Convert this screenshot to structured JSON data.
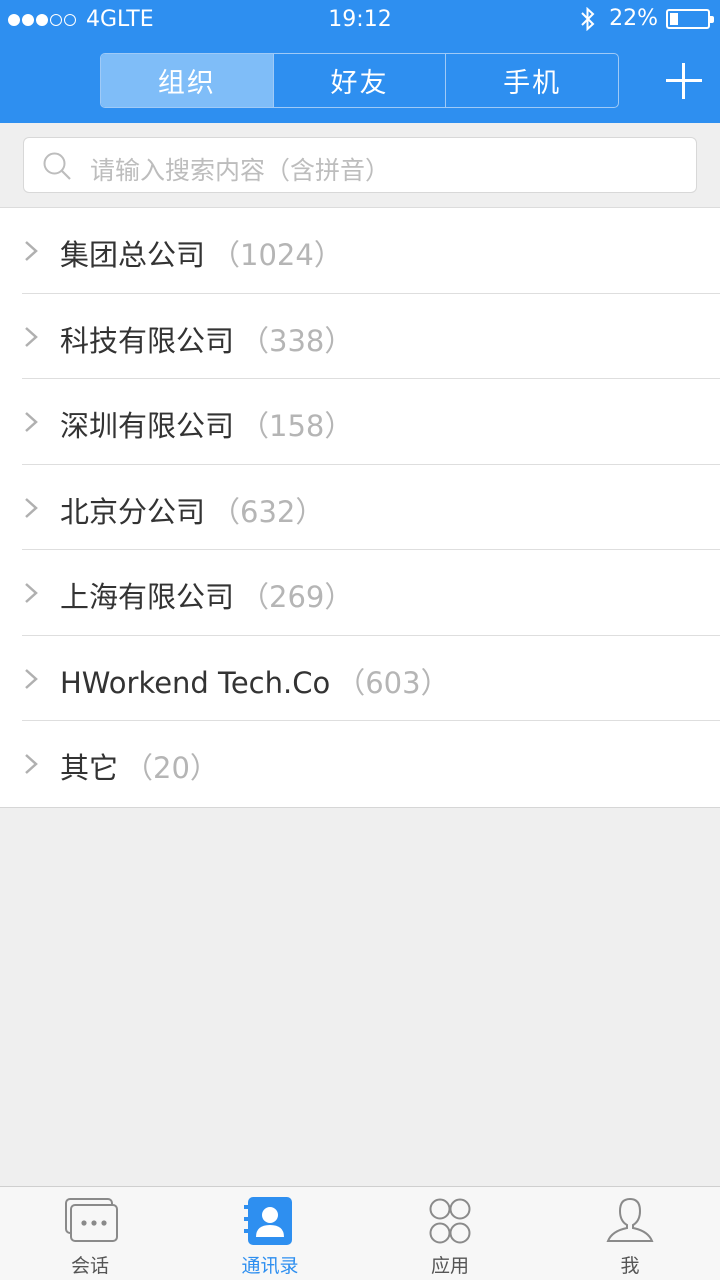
{
  "status_bar": {
    "carrier": "4GLTE",
    "time": "19:12",
    "battery": "22%",
    "battery_level": 0.22,
    "signal_bars": 3
  },
  "segments": [
    {
      "label": "组织",
      "active": true
    },
    {
      "label": "好友",
      "active": false
    },
    {
      "label": "手机",
      "active": false
    }
  ],
  "search": {
    "placeholder": "请输入搜索内容（含拼音）"
  },
  "groups": [
    {
      "name": "集团总公司",
      "count": "（1024）"
    },
    {
      "name": "科技有限公司",
      "count": "（338）"
    },
    {
      "name": "深圳有限公司",
      "count": "（158）"
    },
    {
      "name": "北京分公司",
      "count": "（632）"
    },
    {
      "name": "上海有限公司",
      "count": "（269）"
    },
    {
      "name": "HWorkend Tech.Co",
      "count": "（603）"
    },
    {
      "name": "其它",
      "count": "（20）"
    }
  ],
  "tabs": [
    {
      "label": "会话",
      "icon": "chat-icon",
      "active": false
    },
    {
      "label": "通讯录",
      "icon": "contacts-icon",
      "active": true
    },
    {
      "label": "应用",
      "icon": "apps-icon",
      "active": false
    },
    {
      "label": "我",
      "icon": "profile-icon",
      "active": false
    }
  ],
  "colors": {
    "accent": "#2e8ff0",
    "segment_active": "#7fbdf8",
    "count_text": "#b5b5b5"
  }
}
